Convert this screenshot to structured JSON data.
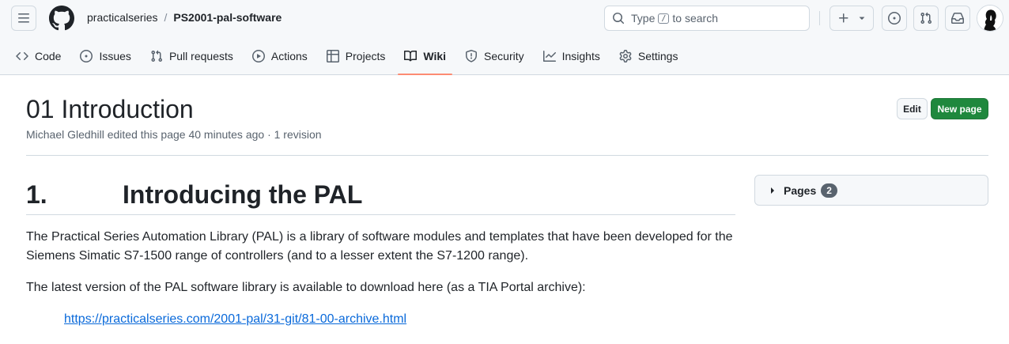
{
  "header": {
    "owner": "practicalseries",
    "separator": "/",
    "repo": "PS2001-pal-software",
    "search": {
      "prefix": "Type",
      "key": "/",
      "suffix": "to search"
    }
  },
  "nav": {
    "items": [
      {
        "label": "Code",
        "icon": "code-icon"
      },
      {
        "label": "Issues",
        "icon": "issue-opened-icon"
      },
      {
        "label": "Pull requests",
        "icon": "git-pull-request-icon"
      },
      {
        "label": "Actions",
        "icon": "play-icon"
      },
      {
        "label": "Projects",
        "icon": "table-icon"
      },
      {
        "label": "Wiki",
        "icon": "book-icon",
        "selected": true
      },
      {
        "label": "Security",
        "icon": "shield-icon"
      },
      {
        "label": "Insights",
        "icon": "graph-icon"
      },
      {
        "label": "Settings",
        "icon": "gear-icon"
      }
    ],
    "selected_underline_color": "#fd8c73"
  },
  "page": {
    "title": "01 Introduction",
    "meta": "Michael Gledhill edited this page 40 minutes ago · 1 revision",
    "edit_label": "Edit",
    "new_page_label": "New page"
  },
  "article": {
    "heading_number": "1.",
    "heading_text": "Introducing the PAL",
    "paragraph1": "The Practical Series Automation Library (PAL) is a library of software modules and templates that have been developed for the Siemens Simatic S7-1500 range of controllers (and to a lesser extent the S7-1200 range).",
    "paragraph2": "The latest version of the PAL software library is available to download here (as a TIA Portal archive):",
    "link_text": "https://practicalseries.com/2001-pal/31-git/81-00-archive.html"
  },
  "sidebar": {
    "pages_label": "Pages",
    "pages_count": "2"
  },
  "colors": {
    "primary_button": "#1f883d",
    "link": "#0969da",
    "counter_bg": "#59636e"
  }
}
